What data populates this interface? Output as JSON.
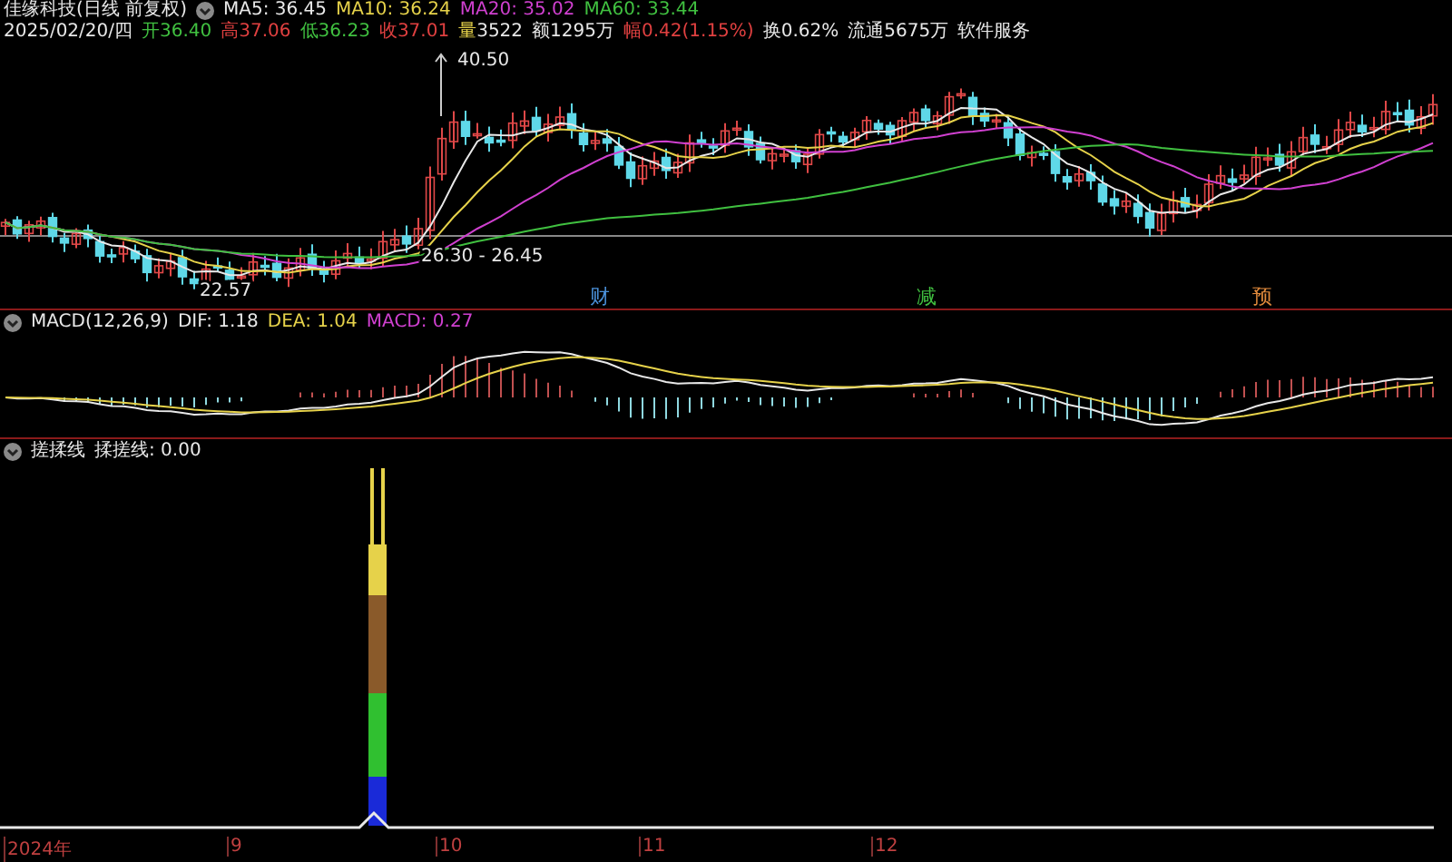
{
  "header": {
    "title": "佳缘科技(日线 前复权)",
    "moving_averages": [
      {
        "label": "MA5: 36.45",
        "color": "#e8e8e8"
      },
      {
        "label": "MA10: 36.24",
        "color": "#e6d24a"
      },
      {
        "label": "MA20: 35.02",
        "color": "#d040d0"
      },
      {
        "label": "MA60: 33.44",
        "color": "#40c040"
      }
    ]
  },
  "quote": [
    {
      "label": "2025/02/20/四",
      "kind": "plain"
    },
    {
      "label": "开",
      "value": "36.40",
      "kind": "down"
    },
    {
      "label": "高",
      "value": "37.06",
      "kind": "up"
    },
    {
      "label": "低",
      "value": "36.23",
      "kind": "down"
    },
    {
      "label": "收",
      "value": "37.01",
      "kind": "up"
    },
    {
      "label": "量",
      "value": "3522",
      "kind": "volume"
    },
    {
      "label": "额",
      "value": "1295万",
      "kind": "plain"
    },
    {
      "label": "幅",
      "value": "0.42(1.15%)",
      "kind": "up"
    },
    {
      "label": "换",
      "value": "0.62%",
      "kind": "plain"
    },
    {
      "label": "流通",
      "value": "5675万",
      "kind": "plain"
    },
    {
      "label": "软件服务",
      "kind": "plain"
    }
  ],
  "price_chart": {
    "high_label": "40.50",
    "low_label": "22.57",
    "range_label": "26.30 - 26.45",
    "events": [
      {
        "label": "财",
        "color": "#4a90d9"
      },
      {
        "label": "减",
        "color": "#40c040"
      },
      {
        "label": "预",
        "color": "#e08a3c"
      }
    ]
  },
  "macd": {
    "title": "MACD(12,26,9)",
    "values": [
      {
        "label": "DIF: 1.18",
        "color": "#e8e8e8"
      },
      {
        "label": "DEA: 1.04",
        "color": "#e6d24a"
      },
      {
        "label": "MACD: 0.27",
        "color": "#d040d0"
      }
    ]
  },
  "indicator": {
    "title": "搓揉线",
    "value": "揉搓线: 0.00"
  },
  "time_axis": [
    "2024年",
    "9",
    "10",
    "11",
    "12"
  ]
}
